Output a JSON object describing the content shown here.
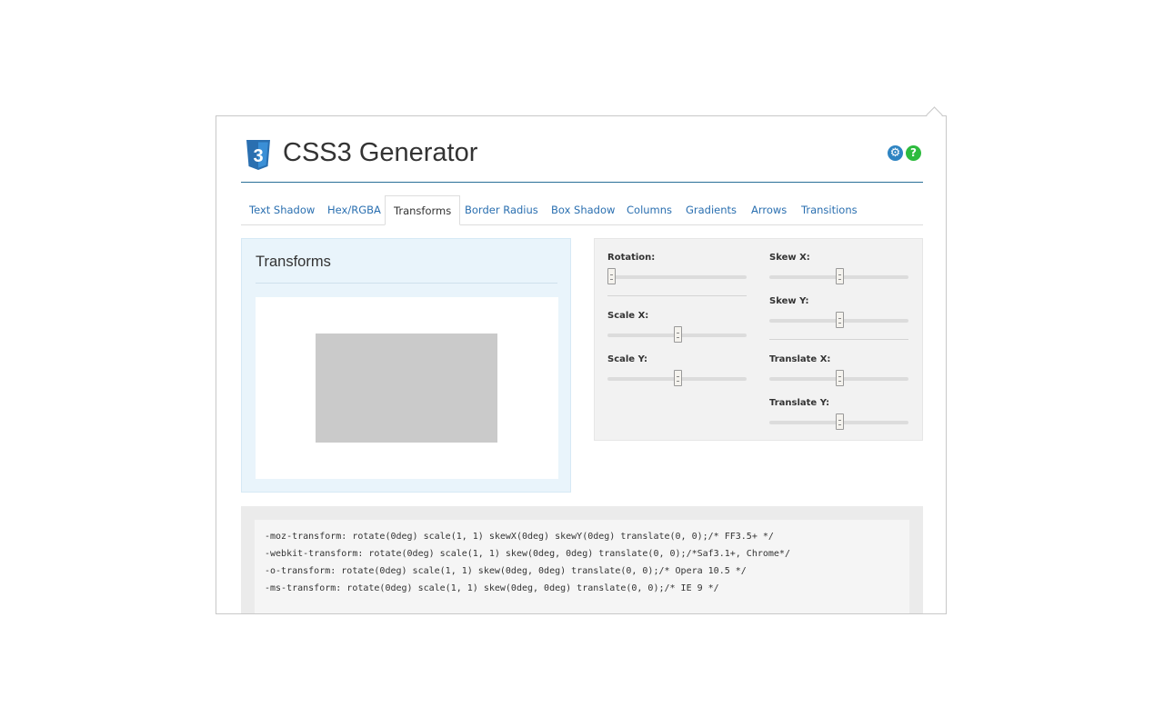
{
  "app": {
    "title": "CSS3 Generator",
    "logo_label": "3"
  },
  "header_icons": {
    "settings": "gear-icon",
    "help": "help-icon",
    "gear_glyph": "⚙",
    "help_glyph": "?"
  },
  "tabs": [
    {
      "label": "Text Shadow",
      "active": false
    },
    {
      "label": "Hex/RGBA",
      "active": false
    },
    {
      "label": "Transforms",
      "active": true
    },
    {
      "label": "Border Radius",
      "active": false
    },
    {
      "label": "Box Shadow",
      "active": false
    },
    {
      "label": "Columns",
      "active": false
    },
    {
      "label": "Gradients",
      "active": false
    },
    {
      "label": "Arrows",
      "active": false
    },
    {
      "label": "Transitions",
      "active": false
    }
  ],
  "preview": {
    "title": "Transforms"
  },
  "controls": {
    "rotation": {
      "label": "Rotation:",
      "value_fraction": 0.0
    },
    "scale_x": {
      "label": "Scale X:",
      "value_fraction": 0.5
    },
    "scale_y": {
      "label": "Scale Y:",
      "value_fraction": 0.5
    },
    "skew_x": {
      "label": "Skew X:",
      "value_fraction": 0.5
    },
    "skew_y": {
      "label": "Skew Y:",
      "value_fraction": 0.5
    },
    "translate_x": {
      "label": "Translate X:",
      "value_fraction": 0.5
    },
    "translate_y": {
      "label": "Translate Y:",
      "value_fraction": 0.5
    }
  },
  "code": {
    "lines": [
      "-moz-transform: rotate(0deg) scale(1, 1) skewX(0deg) skewY(0deg) translate(0, 0);/* FF3.5+ */",
      "-webkit-transform: rotate(0deg) scale(1, 1) skew(0deg, 0deg) translate(0, 0);/*Saf3.1+, Chrome*/",
      "-o-transform: rotate(0deg) scale(1, 1) skew(0deg, 0deg) translate(0, 0);/* Opera 10.5 */",
      "-ms-transform: rotate(0deg) scale(1, 1) skew(0deg, 0deg) translate(0, 0);/* IE 9 */"
    ]
  },
  "colors": {
    "accent": "#2a6fb0",
    "header_rule": "#2a6f97",
    "preview_bg": "#e9f4fb",
    "settings_icon": "#2e84c2",
    "help_icon": "#2dbb3e"
  }
}
